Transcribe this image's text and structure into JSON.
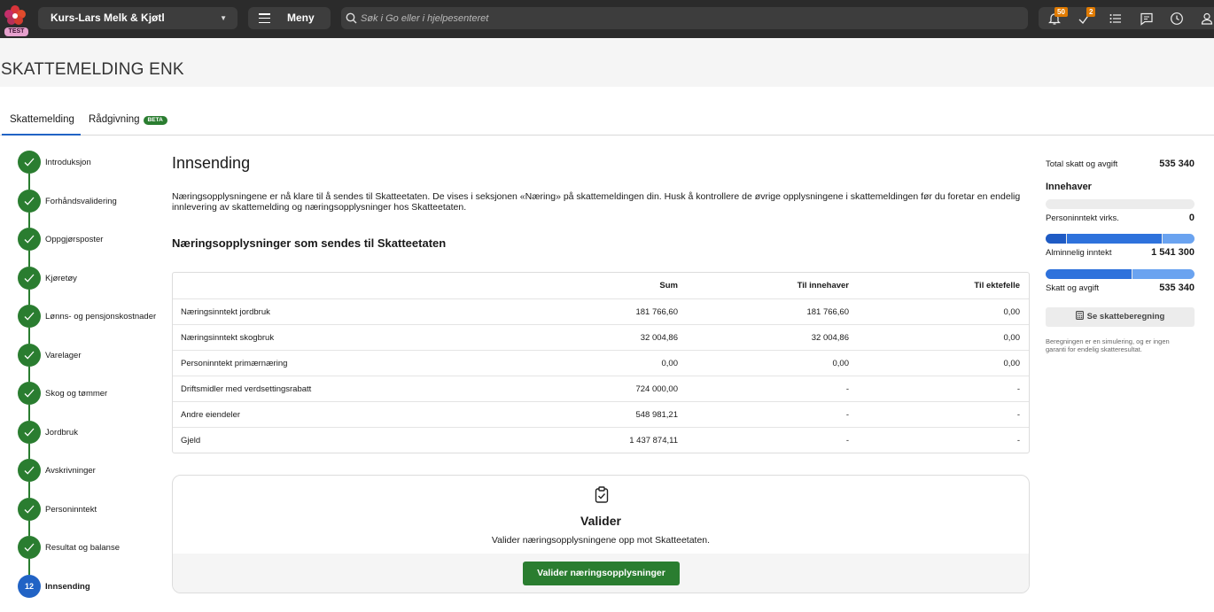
{
  "app": {
    "env_badge": "TEST",
    "company": "Kurs-Lars Melk & Kjøtl",
    "menu_label": "Meny",
    "search_placeholder": "Søk i Go eller i hjelpesenteret",
    "notifications_count": "50",
    "tasks_count": "2"
  },
  "page": {
    "title": "SKATTEMELDING ENK",
    "tabs": [
      {
        "label": "Skattemelding",
        "active": true
      },
      {
        "label": "Rådgivning",
        "badge": "BETA",
        "active": false
      }
    ]
  },
  "steps": [
    {
      "label": "Introduksjon",
      "status": "done"
    },
    {
      "label": "Forhåndsvalidering",
      "status": "done"
    },
    {
      "label": "Oppgjørsposter",
      "status": "done"
    },
    {
      "label": "Kjøretøy",
      "status": "done"
    },
    {
      "label": "Lønns- og pensjonskostnader",
      "status": "done"
    },
    {
      "label": "Varelager",
      "status": "done"
    },
    {
      "label": "Skog og tømmer",
      "status": "done"
    },
    {
      "label": "Jordbruk",
      "status": "done"
    },
    {
      "label": "Avskrivninger",
      "status": "done"
    },
    {
      "label": "Personinntekt",
      "status": "done"
    },
    {
      "label": "Resultat og balanse",
      "status": "done"
    },
    {
      "label": "Innsending",
      "status": "current",
      "number": "12"
    }
  ],
  "main": {
    "heading": "Innsending",
    "intro": "Næringsopplysningene er nå klare til å sendes til Skatteetaten. De vises i seksjonen «Næring» på skattemeldingen din. Husk å kontrollere de øvrige opplysningene i skattemeldingen før du foretar en endelig innlevering av skattemelding og næringsopplysninger hos Skatteetaten.",
    "section_title": "Næringsopplysninger som sendes til Skatteetaten",
    "table": {
      "headers": [
        "",
        "Sum",
        "Til innehaver",
        "Til ektefelle"
      ],
      "rows": [
        [
          "Næringsinntekt jordbruk",
          "181 766,60",
          "181 766,60",
          "0,00"
        ],
        [
          "Næringsinntekt skogbruk",
          "32 004,86",
          "32 004,86",
          "0,00"
        ],
        [
          "Personinntekt primærnæring",
          "0,00",
          "0,00",
          "0,00"
        ],
        [
          "Driftsmidler med verdsettingsrabatt",
          "724 000,00",
          "-",
          "-"
        ],
        [
          "Andre eiendeler",
          "548 981,21",
          "-",
          "-"
        ],
        [
          "Gjeld",
          "1 437 874,11",
          "-",
          "-"
        ]
      ]
    },
    "validate": {
      "title": "Valider",
      "subtitle": "Valider næringsopplysningene opp mot Skatteetaten.",
      "button": "Valider næringsopplysninger"
    }
  },
  "summary": {
    "total_label": "Total skatt og avgift",
    "total_value": "535 340",
    "owner_heading": "Innehaver",
    "personinntekt_label": "Personinntekt virks.",
    "personinntekt_value": "0",
    "alminnelig_label": "Alminnelig inntekt",
    "alminnelig_value": "1 541 300",
    "skatt_label": "Skatt og avgift",
    "skatt_value": "535 340",
    "button": "Se skatteberegning",
    "note": "Beregningen er en simulering, og er ingen garanti for endelig skatteresultat.",
    "colors": {
      "dark_blue": "#1f5bc4",
      "mid_blue": "#2e72dc",
      "light_blue": "#6aa3f0",
      "track": "#ececec"
    }
  }
}
